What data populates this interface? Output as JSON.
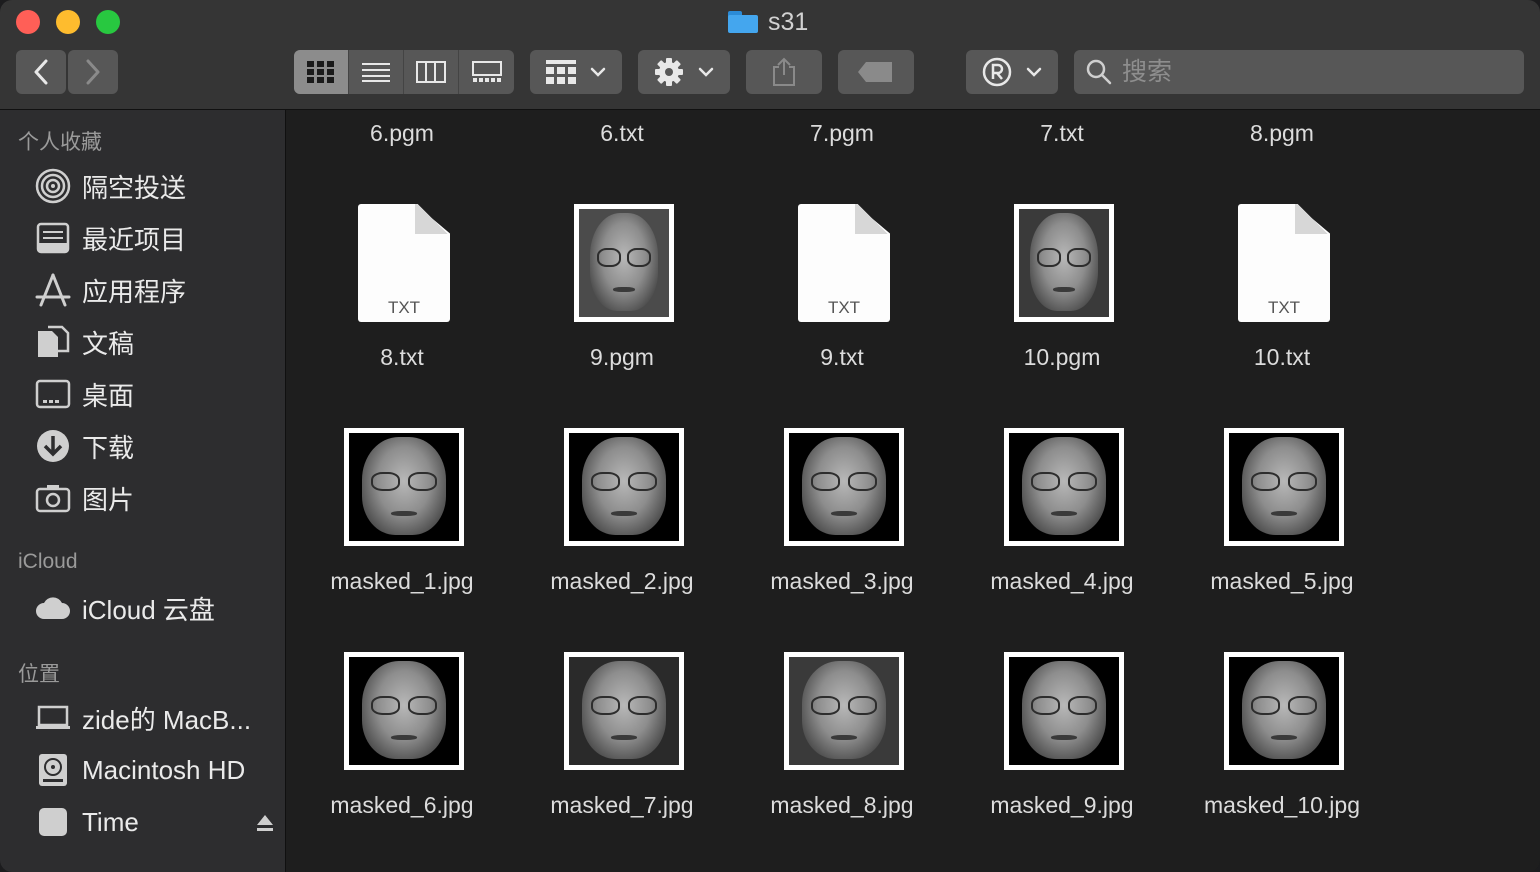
{
  "window": {
    "title": "s31",
    "colors": {
      "red": "#ff5f57",
      "yellow": "#febc2e",
      "green": "#28c840",
      "folder": "#44a6ee"
    }
  },
  "toolbar": {
    "back_icon": "chevron-left-icon",
    "forward_icon": "chevron-right-icon",
    "view_modes": [
      "icon-view-icon",
      "list-view-icon",
      "column-view-icon",
      "gallery-view-icon"
    ],
    "active_view": "icon-view-icon",
    "search": {
      "placeholder": "搜索"
    }
  },
  "sidebar": {
    "favorites_title": "个人收藏",
    "favorites": [
      {
        "label": "隔空投送",
        "icon": "airdrop-icon"
      },
      {
        "label": "最近项目",
        "icon": "recents-icon"
      },
      {
        "label": "应用程序",
        "icon": "applications-icon"
      },
      {
        "label": "文稿",
        "icon": "documents-icon"
      },
      {
        "label": "桌面",
        "icon": "desktop-icon"
      },
      {
        "label": "下载",
        "icon": "downloads-icon"
      },
      {
        "label": "图片",
        "icon": "pictures-icon"
      }
    ],
    "icloud_title": "iCloud",
    "icloud": [
      {
        "label": "iCloud 云盘",
        "icon": "cloud-icon"
      }
    ],
    "locations_title": "位置",
    "locations": [
      {
        "label": "zide的 MacB...",
        "icon": "laptop-icon"
      },
      {
        "label": "Macintosh HD",
        "icon": "hard-drive-icon"
      },
      {
        "label": "Time",
        "icon": "external-drive-icon"
      }
    ]
  },
  "files": {
    "top_row": [
      "6.pgm",
      "6.txt",
      "7.pgm",
      "7.txt",
      "8.pgm"
    ],
    "row2": [
      {
        "name": "8.txt",
        "kind": "txt",
        "badge": "TXT"
      },
      {
        "name": "9.pgm",
        "kind": "image"
      },
      {
        "name": "9.txt",
        "kind": "txt",
        "badge": "TXT"
      },
      {
        "name": "10.pgm",
        "kind": "image"
      },
      {
        "name": "10.txt",
        "kind": "txt",
        "badge": "TXT"
      }
    ],
    "row3": [
      "masked_1.jpg",
      "masked_2.jpg",
      "masked_3.jpg",
      "masked_4.jpg",
      "masked_5.jpg"
    ],
    "row4": [
      "masked_6.jpg",
      "masked_7.jpg",
      "masked_8.jpg",
      "masked_9.jpg",
      "masked_10.jpg"
    ]
  }
}
